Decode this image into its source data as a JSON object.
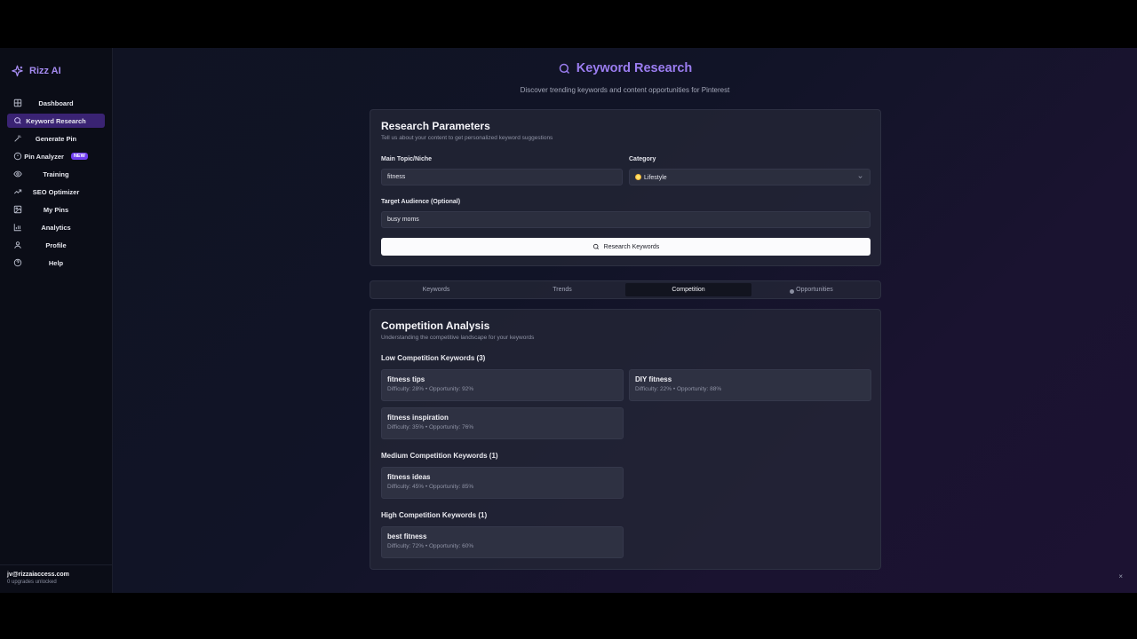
{
  "brand": {
    "name": "Rizz AI",
    "icon": "sparkles-icon"
  },
  "sidebar": {
    "items": [
      {
        "label": "Dashboard",
        "icon": "grid-icon",
        "active": false
      },
      {
        "label": "Keyword Research",
        "icon": "search-icon",
        "active": true
      },
      {
        "label": "Generate Pin",
        "icon": "wand-icon",
        "active": false
      },
      {
        "label": "Pin Analyzer",
        "icon": "target-icon",
        "active": false,
        "badge": "NEW"
      },
      {
        "label": "Training",
        "icon": "eye-icon",
        "active": false
      },
      {
        "label": "SEO Optimizer",
        "icon": "trend-icon",
        "active": false
      },
      {
        "label": "My Pins",
        "icon": "image-icon",
        "active": false
      },
      {
        "label": "Analytics",
        "icon": "bar-chart-icon",
        "active": false
      },
      {
        "label": "Profile",
        "icon": "user-icon",
        "active": false
      },
      {
        "label": "Help",
        "icon": "help-circle-icon",
        "active": false
      }
    ],
    "footer": {
      "email": "jv@rizzaiaccess.com",
      "subtext": "0 upgrades unlocked"
    }
  },
  "header": {
    "title": "Keyword Research",
    "subtitle": "Discover trending keywords and content opportunities for Pinterest"
  },
  "params": {
    "title": "Research Parameters",
    "description": "Tell us about your content to get personalized keyword suggestions",
    "topic_label": "Main Topic/Niche",
    "topic_value": "fitness",
    "category_label": "Category",
    "category_value": "Lifestyle",
    "audience_label": "Target Audience (Optional)",
    "audience_value": "busy moms",
    "button_label": "Research Keywords"
  },
  "tabs": [
    {
      "label": "Keywords",
      "active": false
    },
    {
      "label": "Trends",
      "active": false
    },
    {
      "label": "Competition",
      "active": true
    },
    {
      "label": "Opportunities",
      "active": false
    }
  ],
  "analysis": {
    "title": "Competition Analysis",
    "description": "Understanding the competitive landscape for your keywords",
    "low": {
      "title": "Low Competition Keywords (3)",
      "items": [
        {
          "name": "fitness tips",
          "stats": "Difficulty: 28% • Opportunity: 92%"
        },
        {
          "name": "DIY fitness",
          "stats": "Difficulty: 22% • Opportunity: 88%"
        },
        {
          "name": "fitness inspiration",
          "stats": "Difficulty: 35% • Opportunity: 76%"
        }
      ]
    },
    "medium": {
      "title": "Medium Competition Keywords (1)",
      "items": [
        {
          "name": "fitness ideas",
          "stats": "Difficulty: 45% • Opportunity: 85%"
        }
      ]
    },
    "high": {
      "title": "High Competition Keywords (1)",
      "items": [
        {
          "name": "best fitness",
          "stats": "Difficulty: 72% • Opportunity: 60%"
        }
      ]
    }
  },
  "close_label": "×",
  "colors": {
    "accent": "#9b7df0",
    "active_nav": "#3a2373",
    "badge": "#6f3df0"
  }
}
